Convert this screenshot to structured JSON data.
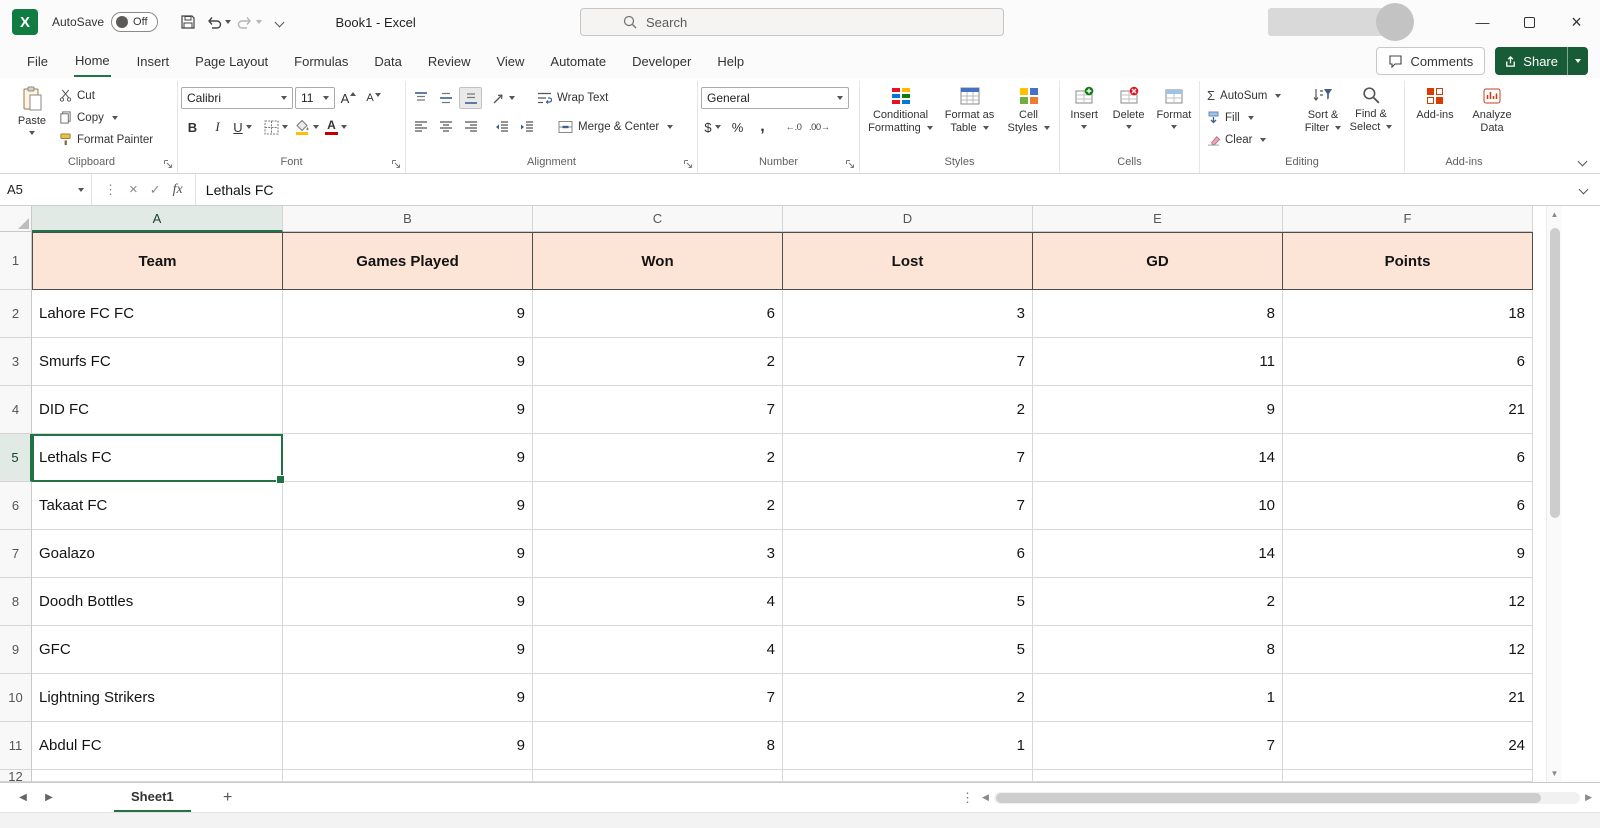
{
  "titlebar": {
    "logo_letter": "X",
    "autosave_label": "AutoSave",
    "autosave_state": "Off",
    "doc_title": "Book1  -  Excel",
    "search_placeholder": "Search"
  },
  "ribbon_tabs": [
    {
      "label": "File"
    },
    {
      "label": "Home",
      "active": true
    },
    {
      "label": "Insert"
    },
    {
      "label": "Page Layout"
    },
    {
      "label": "Formulas"
    },
    {
      "label": "Data"
    },
    {
      "label": "Review"
    },
    {
      "label": "View"
    },
    {
      "label": "Automate"
    },
    {
      "label": "Developer"
    },
    {
      "label": "Help"
    }
  ],
  "top_right": {
    "comments": "Comments",
    "share": "Share"
  },
  "ribbon": {
    "clipboard": {
      "label": "Clipboard",
      "paste": "Paste",
      "cut": "Cut",
      "copy": "Copy",
      "format_painter": "Format Painter"
    },
    "font": {
      "label": "Font",
      "name": "Calibri",
      "size": "11",
      "bold": "B",
      "italic": "I",
      "underline": "U",
      "grow": "A",
      "shrink": "A",
      "color_letter": "A"
    },
    "alignment": {
      "label": "Alignment",
      "wrap_text": "Wrap Text",
      "merge_center": "Merge & Center"
    },
    "number": {
      "label": "Number",
      "format": "General",
      "dollar": "$",
      "percent": "%",
      "comma": ",",
      "inc_decimal": "←.0",
      "dec_decimal": ".00→"
    },
    "styles": {
      "label": "Styles",
      "conditional": "Conditional Formatting",
      "format_table": "Format as Table",
      "cell_styles": "Cell Styles"
    },
    "cells": {
      "label": "Cells",
      "insert": "Insert",
      "delete": "Delete",
      "format": "Format"
    },
    "editing": {
      "label": "Editing",
      "autosum": "AutoSum",
      "fill": "Fill",
      "clear": "Clear",
      "sort_filter": "Sort & Filter",
      "find_select": "Find & Select"
    },
    "addins": {
      "label": "Add-ins",
      "addins": "Add-ins",
      "analyze": "Analyze Data"
    }
  },
  "formula_bar": {
    "name_box": "A5",
    "content": "Lethals FC"
  },
  "grid": {
    "columns": [
      "A",
      "B",
      "C",
      "D",
      "E",
      "F"
    ],
    "selected_cell": {
      "ref": "A5",
      "column": "A",
      "row": "5"
    },
    "header_row": {
      "num": "1",
      "cells": [
        "Team",
        "Games Played",
        "Won",
        "Lost",
        "GD",
        "Points"
      ]
    },
    "rows": [
      {
        "num": "2",
        "cells": [
          "Lahore FC FC",
          "9",
          "6",
          "3",
          "8",
          "18"
        ]
      },
      {
        "num": "3",
        "cells": [
          "Smurfs FC",
          "9",
          "2",
          "7",
          "11",
          "6"
        ]
      },
      {
        "num": "4",
        "cells": [
          "DID FC",
          "9",
          "7",
          "2",
          "9",
          "21"
        ]
      },
      {
        "num": "5",
        "cells": [
          "Lethals FC",
          "9",
          "2",
          "7",
          "14",
          "6"
        ]
      },
      {
        "num": "6",
        "cells": [
          "Takaat FC",
          "9",
          "2",
          "7",
          "10",
          "6"
        ]
      },
      {
        "num": "7",
        "cells": [
          "Goalazo",
          "9",
          "3",
          "6",
          "14",
          "9"
        ]
      },
      {
        "num": "8",
        "cells": [
          "Doodh Bottles",
          "9",
          "4",
          "5",
          "2",
          "12"
        ]
      },
      {
        "num": "9",
        "cells": [
          "GFC",
          "9",
          "4",
          "5",
          "8",
          "12"
        ]
      },
      {
        "num": "10",
        "cells": [
          "Lightning Strikers",
          "9",
          "7",
          "2",
          "1",
          "21"
        ]
      },
      {
        "num": "11",
        "cells": [
          "Abdul FC",
          "9",
          "8",
          "1",
          "7",
          "24"
        ]
      }
    ],
    "partial_row_num": "12"
  },
  "sheetbar": {
    "active_tab": "Sheet1"
  },
  "icons": {
    "sigma": "Σ",
    "fx": "fx",
    "close_x": "×",
    "check": "✓",
    "ellipsis": "⋮",
    "plus": "+",
    "left_tri": "◀",
    "right_tri": "▶",
    "up_tri": "▲",
    "down_tri": "▼",
    "minimize": "—"
  },
  "colors": {
    "accent_green": "#217346",
    "share_green": "#185C37",
    "logo_green": "#107C41",
    "header_fill": "#FCE4D6"
  }
}
